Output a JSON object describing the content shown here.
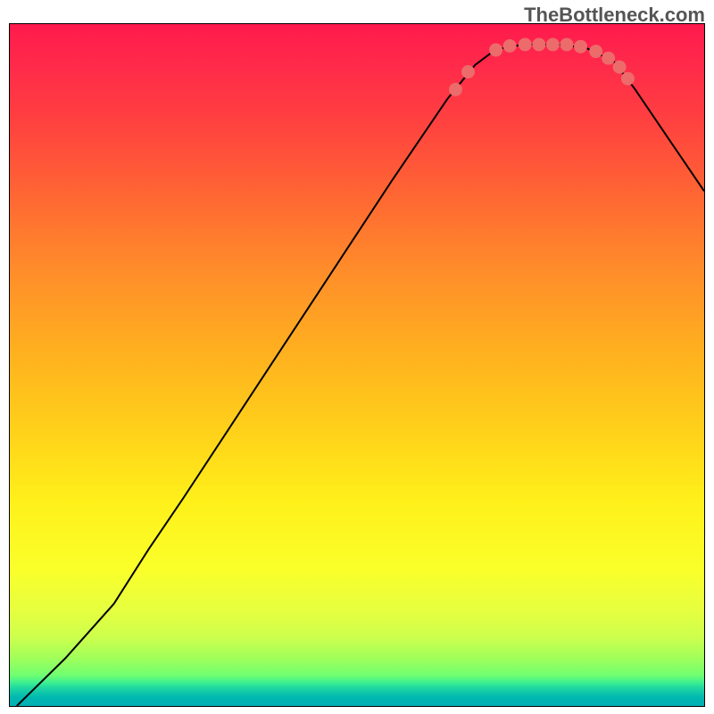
{
  "attribution": "TheBottleneck.com",
  "chart_data": {
    "type": "line",
    "title": "",
    "xlabel": "",
    "ylabel": "",
    "xlim": [
      0,
      1
    ],
    "ylim": [
      0,
      1
    ],
    "curve": [
      {
        "x": 0.01,
        "y": 0.0
      },
      {
        "x": 0.08,
        "y": 0.07
      },
      {
        "x": 0.15,
        "y": 0.15
      },
      {
        "x": 0.2,
        "y": 0.23
      },
      {
        "x": 0.25,
        "y": 0.305
      },
      {
        "x": 0.35,
        "y": 0.46
      },
      {
        "x": 0.45,
        "y": 0.615
      },
      {
        "x": 0.55,
        "y": 0.77
      },
      {
        "x": 0.63,
        "y": 0.89
      },
      {
        "x": 0.67,
        "y": 0.94
      },
      {
        "x": 0.7,
        "y": 0.963
      },
      {
        "x": 0.74,
        "y": 0.97
      },
      {
        "x": 0.79,
        "y": 0.97
      },
      {
        "x": 0.83,
        "y": 0.965
      },
      {
        "x": 0.87,
        "y": 0.945
      },
      {
        "x": 0.9,
        "y": 0.905
      },
      {
        "x": 0.95,
        "y": 0.83
      },
      {
        "x": 1.0,
        "y": 0.755
      }
    ],
    "dots": [
      {
        "x": 0.642,
        "y": 0.904
      },
      {
        "x": 0.66,
        "y": 0.93
      },
      {
        "x": 0.7,
        "y": 0.962
      },
      {
        "x": 0.72,
        "y": 0.968
      },
      {
        "x": 0.742,
        "y": 0.97
      },
      {
        "x": 0.762,
        "y": 0.97
      },
      {
        "x": 0.782,
        "y": 0.97
      },
      {
        "x": 0.802,
        "y": 0.97
      },
      {
        "x": 0.822,
        "y": 0.967
      },
      {
        "x": 0.844,
        "y": 0.96
      },
      {
        "x": 0.862,
        "y": 0.95
      },
      {
        "x": 0.878,
        "y": 0.937
      },
      {
        "x": 0.89,
        "y": 0.92
      }
    ],
    "dot_color": "#ec6b6b",
    "curve_color": "#000000"
  }
}
